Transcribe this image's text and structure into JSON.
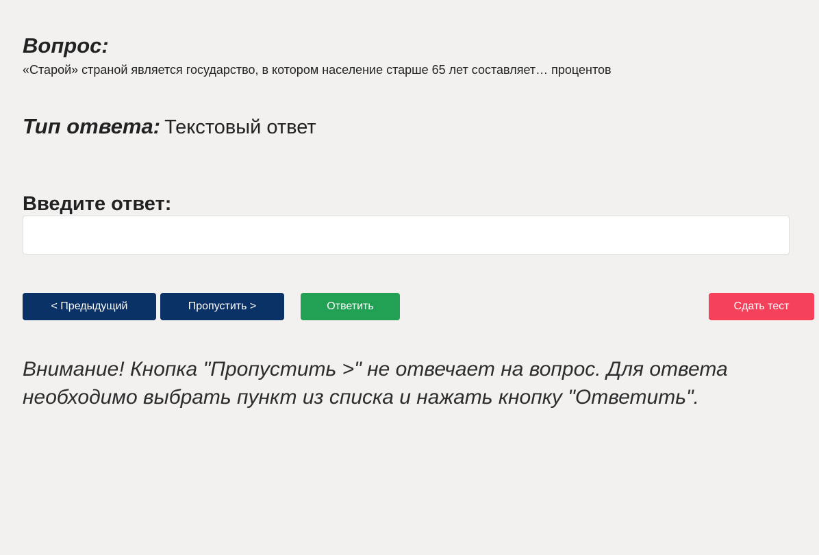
{
  "question": {
    "heading": "Вопрос:",
    "text": "«Старой» страной является государство, в котором население старше 65 лет составляет… процентов"
  },
  "answer_type": {
    "label": "Тип ответа:",
    "value": "Текстовый ответ"
  },
  "answer_input": {
    "label": "Введите ответ:",
    "value": "",
    "placeholder": ""
  },
  "buttons": {
    "previous": "< Предыдущий",
    "skip": "Пропустить >",
    "answer": "Ответить",
    "finish": "Сдать тест"
  },
  "warning": "Внимание! Кнопка \"Пропустить >\" не отвечает на вопрос. Для ответа необходимо выбрать пункт из списка и нажать кнопку \"Ответить\".",
  "colors": {
    "background": "#f2f1ef",
    "primary_navy": "#0b3266",
    "answer_green": "#22a053",
    "finish_red": "#f5425a",
    "text": "#222222"
  }
}
